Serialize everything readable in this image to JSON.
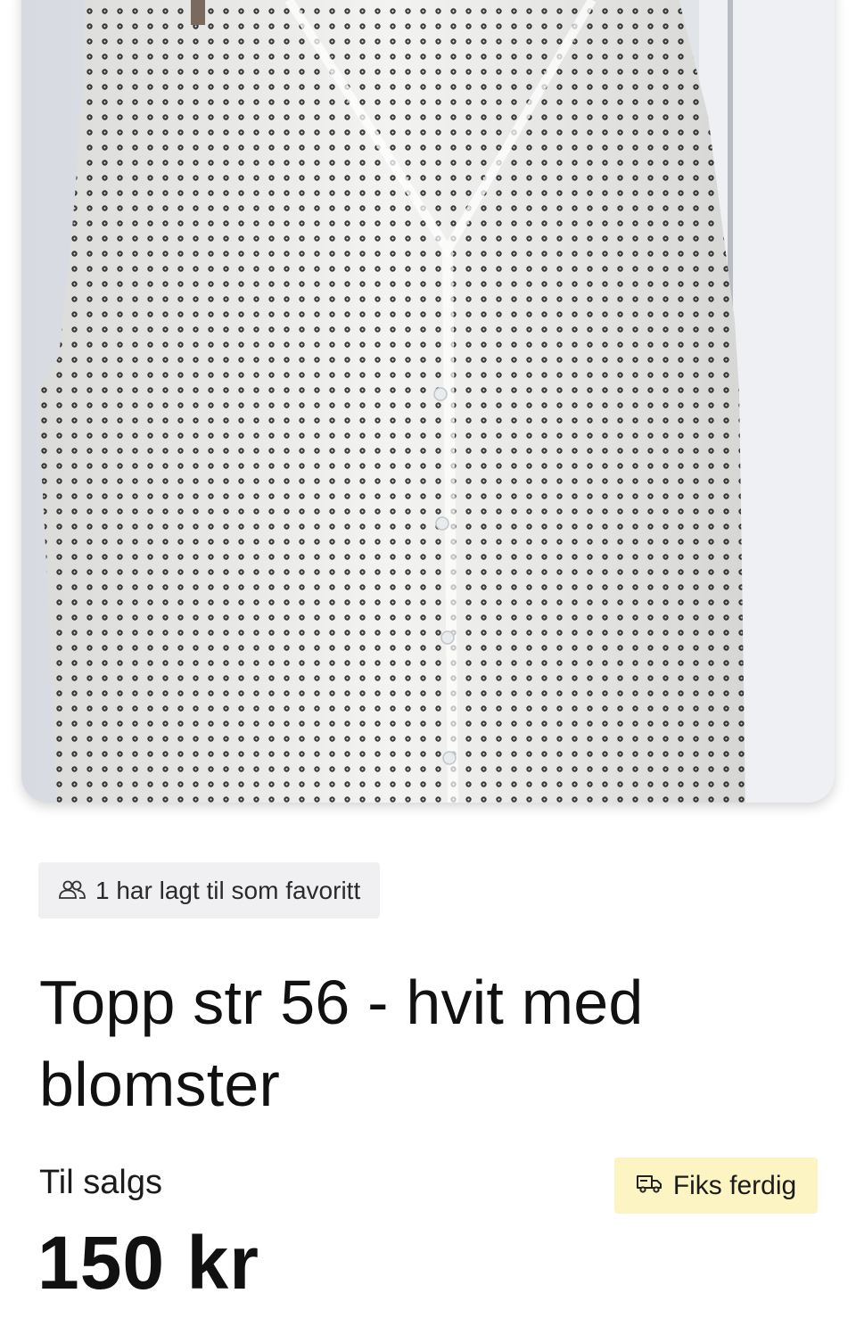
{
  "listing": {
    "image_alt": "Topp str 56 - hvit med blomster",
    "favorites_text": "1 har lagt til som favoritt",
    "title": "Topp str 56 - hvit med blomster",
    "status_label": "Til salgs",
    "price": "150 kr",
    "shipping_badge": "Fiks ferdig"
  },
  "icons": {
    "favorites": "people-icon",
    "shipping": "truck-icon"
  },
  "colors": {
    "shipping_badge_bg": "#fdf4c4",
    "favorites_chip_bg": "#f0f0f3"
  }
}
